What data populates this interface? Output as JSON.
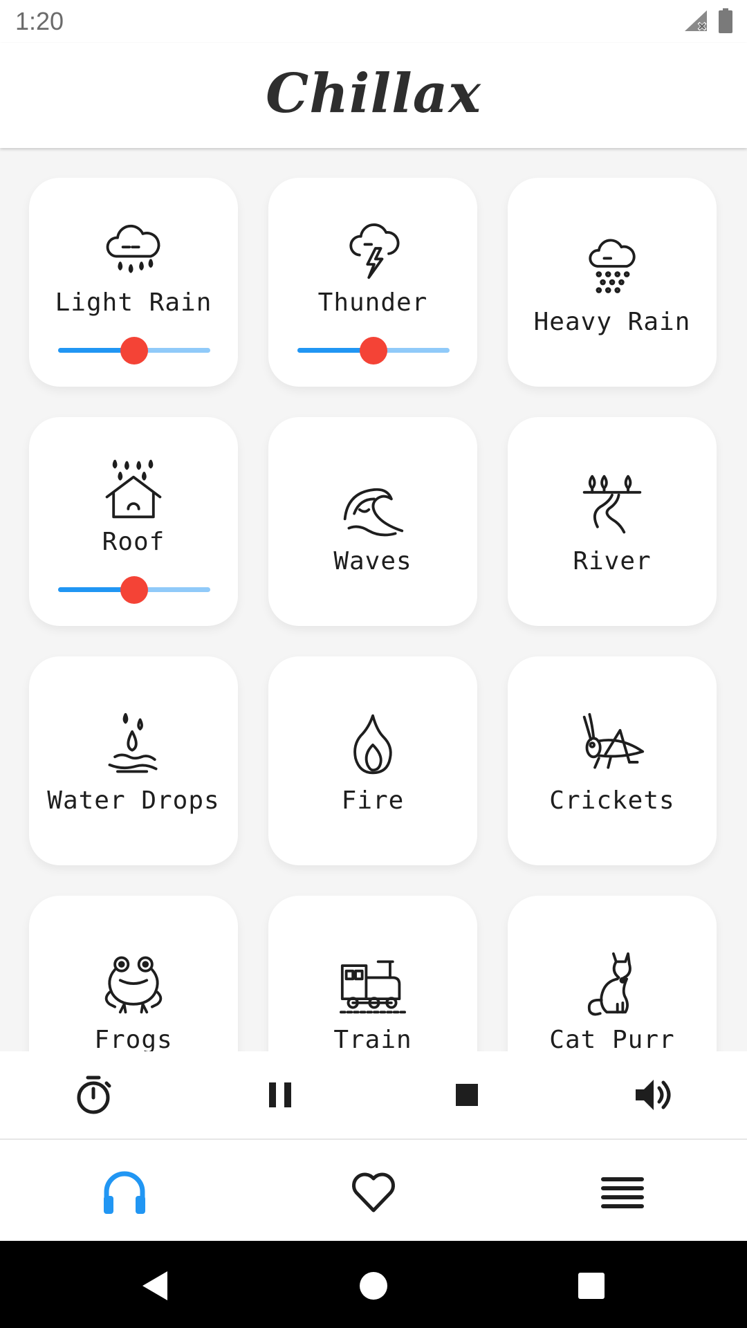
{
  "status": {
    "time": "1:20",
    "icons": [
      "signal-off-icon",
      "battery-icon"
    ]
  },
  "app": {
    "title": "Chillax"
  },
  "sounds": [
    {
      "label": "Light Rain",
      "icon": "light-rain-icon",
      "active": true,
      "volume": 0.5
    },
    {
      "label": "Thunder",
      "icon": "thunder-icon",
      "active": true,
      "volume": 0.5
    },
    {
      "label": "Heavy Rain",
      "icon": "heavy-rain-icon",
      "active": false
    },
    {
      "label": "Roof",
      "icon": "roof-icon",
      "active": true,
      "volume": 0.5
    },
    {
      "label": "Waves",
      "icon": "waves-icon",
      "active": false
    },
    {
      "label": "River",
      "icon": "river-icon",
      "active": false
    },
    {
      "label": "Water Drops",
      "icon": "water-drops-icon",
      "active": false
    },
    {
      "label": "Fire",
      "icon": "fire-icon",
      "active": false
    },
    {
      "label": "Crickets",
      "icon": "crickets-icon",
      "active": false
    },
    {
      "label": "Frogs",
      "icon": "frog-icon",
      "active": false
    },
    {
      "label": "Train",
      "icon": "train-icon",
      "active": false
    },
    {
      "label": "Cat Purr",
      "icon": "cat-icon",
      "active": false
    }
  ],
  "playback_controls": [
    "timer-icon",
    "pause-icon",
    "stop-icon",
    "volume-icon"
  ],
  "bottom_nav": [
    {
      "icon": "headphones-icon",
      "selected": true
    },
    {
      "icon": "heart-icon",
      "selected": false
    },
    {
      "icon": "menu-icon",
      "selected": false
    }
  ],
  "system_nav": [
    "back-icon",
    "home-icon",
    "recents-icon"
  ],
  "colors": {
    "accent": "#2196f3",
    "accent_light": "#90caf9",
    "thumb": "#f44336",
    "background": "#f5f5f5",
    "card": "#ffffff",
    "icon": "#1e1e1e"
  }
}
